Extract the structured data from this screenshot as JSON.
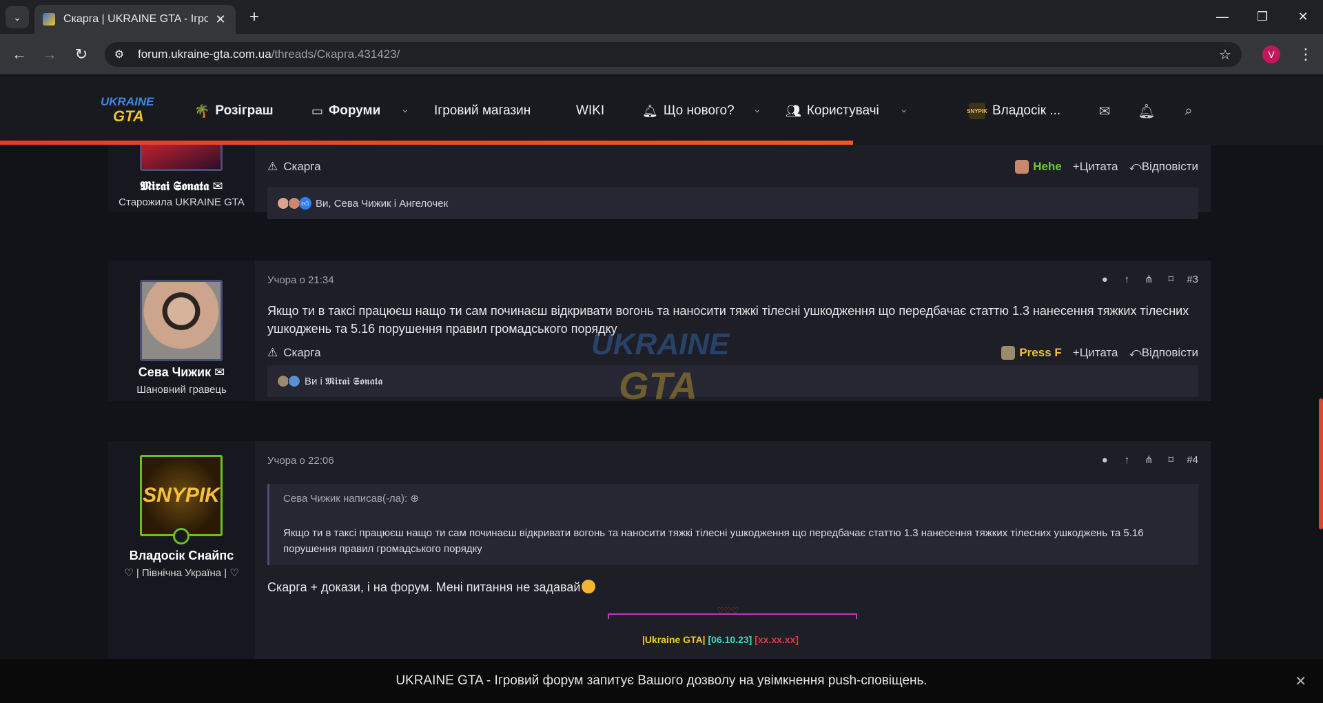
{
  "browser": {
    "tab_title": "Скарга | UKRAINE GTA - Ігрови",
    "url_host": "forum.ukraine-gta.com.ua",
    "url_path": "/threads/Скарга.431423/",
    "profile_initial": "V"
  },
  "header": {
    "logo_top": "UKRAINE",
    "logo_bottom": "GTA",
    "nav": {
      "raffle": "Розіграш",
      "forums": "Форуми",
      "shop": "Ігровий магазин",
      "wiki": "WIKI",
      "whats_new": "Що нового?",
      "users": "Користувачі",
      "current_user": "Владосік ...",
      "current_user_avatar": "SNYPIK"
    }
  },
  "posts": [
    {
      "username": "𝕸𝖎𝖗𝖆𝖎 𝕾𝖔𝖓𝖆𝖙𝖆",
      "user_title": "Старожила UKRAINE GTA",
      "report": "Скарга",
      "reaction": "Hehe",
      "quote": "Цитата",
      "reply": "Відповісти",
      "reactions_text": "Ви, Сева Чижик і Ангелочек"
    },
    {
      "date": "Учора о 21:34",
      "number": "#3",
      "username": "Сева Чижик",
      "user_title": "Шановний гравець",
      "body": "Якщо ти в таксі працюєш нащо ти сам починаєш відкривати вогонь та наносити тяжкі тілесні ушкодження що передбачає статтю 1.3 нанесення тяжких тілесних ушкоджень та 5.16 порушення правил громадського порядку",
      "report": "Скарга",
      "reaction": "Press F",
      "quote": "Цитата",
      "reply": "Відповісти",
      "reactions_text": "Ви і 𝕸𝖎𝖗𝖆𝖎 𝕾𝖔𝖓𝖆𝖙𝖆"
    },
    {
      "date": "Учора о 22:06",
      "number": "#4",
      "username": "Владосік Снайпс",
      "user_title": "♡ | Північна Україна | ♡",
      "avatar_text": "SNYPIK",
      "quote_author": "Сева Чижик написав(-ла):",
      "quote_body": "Якщо ти в таксі працюєш нащо ти сам починаєш відкривати вогонь та наносити тяжкі тілесні ушкодження що передбачає статтю 1.3 нанесення тяжких тілесних ушкоджень та 5.16 порушення правил громадського порядку",
      "body": "Скарга + докази, і на форум. Мені питання не задавай",
      "signature": {
        "hearts": "♡♡♡",
        "part1": "|Ukraine GTA|",
        "part2": "[06.10.23]",
        "part3": "[xx.xx.xx]",
        "color1": "#f2d11c",
        "color2": "#3fd9c2",
        "color3": "#e23b3b"
      }
    }
  ],
  "watermark": {
    "top": "UKRAINE",
    "bottom": "GTA"
  },
  "push_notice": "UKRAINE GTA - Ігровий форум запитує Вашого дозволу на увімкнення push-сповіщень.",
  "colors": {
    "accent": "#e53b2c",
    "hehe": "#6ccc2a",
    "press_f": "#f2c230"
  }
}
